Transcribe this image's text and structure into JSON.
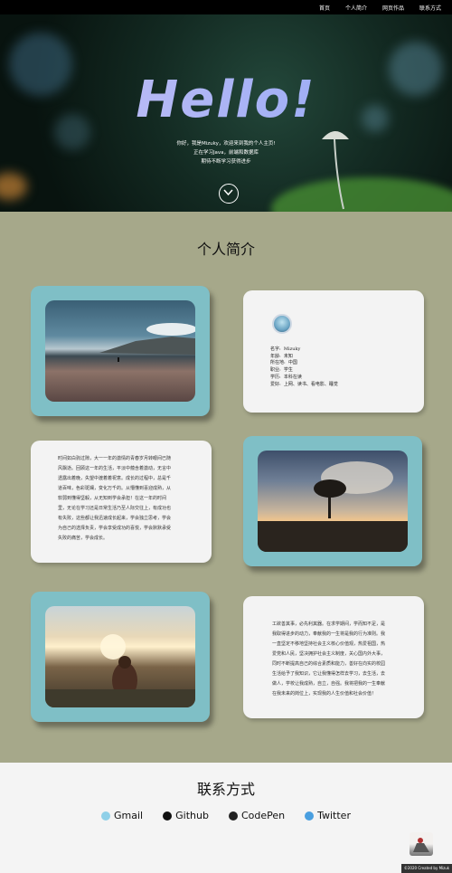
{
  "nav": {
    "items": [
      "首页",
      "个人简介",
      "网页作品",
      "联系方式"
    ]
  },
  "hero": {
    "title": "Hello!",
    "lines": [
      "你好，我是Mizuky，欢迎来到我的个人主页!",
      "正在学习Java，前端和数据库",
      "期待不断学习获得进步"
    ]
  },
  "about": {
    "title": "个人简介",
    "info": [
      {
        "label": "名字:",
        "value": "Mizuky"
      },
      {
        "label": "年龄:",
        "value": "未知"
      },
      {
        "label": "所在地:",
        "value": "中国"
      },
      {
        "label": "职业:",
        "value": "学生"
      },
      {
        "label": "学历:",
        "value": "本科在读"
      },
      {
        "label": "爱好:",
        "value": "上网、读书、看电影、睡觉"
      }
    ],
    "para1": [
      "时间如白驹过隙，大一一年的激情的青春岁月转眼间已随",
      "风飘逝。回顾这一年的生活，平淡中蕴含着激动，无言中",
      "透露出着晚，失望中渡着着祝意。成长的过程中，总是千",
      "道百味，色彩斑斓，变化万千的。从懵懂到喜迎成熟，从",
      "软弱到懂得坚毅，从无知到学会承担！在这一年的时间",
      "里，无论在学习还是日常生活乃至人际交往上，有成功也",
      "有失败，这些都让我迅速成长起来，学会独立思考，学会",
      "为自己的选择负责，学会享受成功的喜悦，学会默默承受",
      "失败的痛苦，学会成长。"
    ],
    "para2": [
      "工欲善其事，必先利其器。在求学期间，学而知不足，是",
      "我取得进步的动力，奉献我的一生将是我的行为准则。我",
      "一直坚定不移地坚持社会主义核心价值观，热爱祖国，热",
      "爱党和人民，坚决拥护社会主义制度，关心国内外大事，",
      "同时不断提高自己的综合素质和能力，善好在向实的校园",
      "生活给予了我知识，它让我懂得怎样去学习，去生活，去",
      "做人，学校让我成熟，自立，自强。我将把我的一生奉献",
      "在我未来的岗位上，实现我的人生价值和社会价值！"
    ]
  },
  "contact": {
    "title": "联系方式",
    "links": [
      {
        "label": "Gmail",
        "icon": "mail-icon"
      },
      {
        "label": "Github",
        "icon": "github-icon"
      },
      {
        "label": "CodePen",
        "icon": "codepen-icon"
      },
      {
        "label": "Twitter",
        "icon": "twitter-icon"
      }
    ]
  },
  "footer": {
    "text": "©2020 Created by Mizuk"
  },
  "colors": {
    "nav": "#000000",
    "body": "#a6a88a",
    "card_frame": "#7fbfc6",
    "card_text": "#f3f3f3",
    "contact_bg": "#f4f4f4"
  }
}
